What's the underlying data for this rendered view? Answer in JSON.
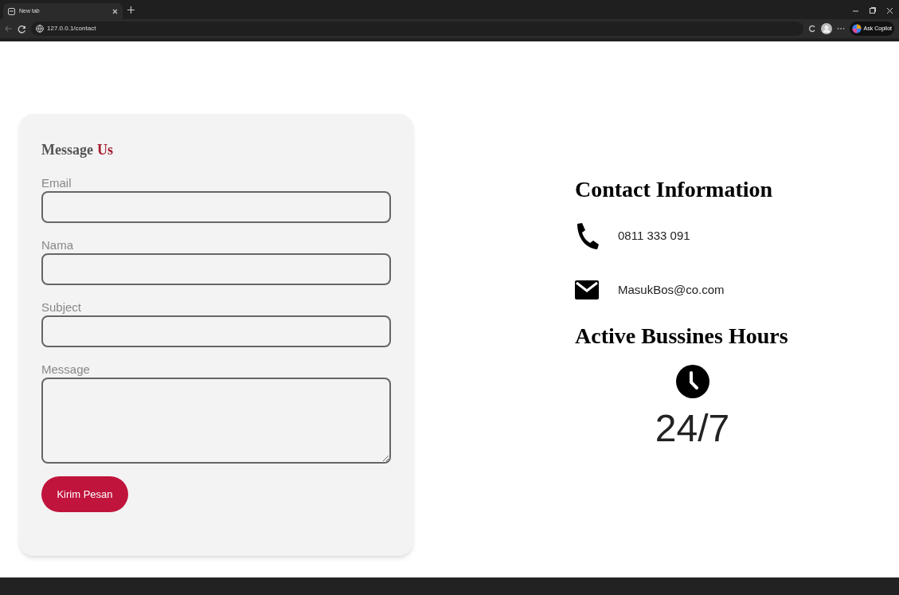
{
  "browser": {
    "tabs": [
      {
        "title": "New tab",
        "selected": true
      }
    ],
    "address": "127.0.0.1/contact",
    "copilot_label": "Ask Copilot"
  },
  "form": {
    "title": "Message",
    "title_accent": "Us",
    "fields": [
      {
        "label": "Email",
        "kind": "input"
      },
      {
        "label": "Nama",
        "kind": "input"
      },
      {
        "label": "Subject",
        "kind": "input"
      },
      {
        "label": "Message",
        "kind": "textarea"
      }
    ],
    "submit": "Kirim Pesan"
  },
  "contact": {
    "title": "Contact Information",
    "items": [
      {
        "kind": "phone",
        "text": "0811 333 091"
      },
      {
        "kind": "email",
        "text": "MasukBos@co.com"
      }
    ],
    "hours_title": "Active Bussines Hours",
    "hours": "24/7"
  }
}
